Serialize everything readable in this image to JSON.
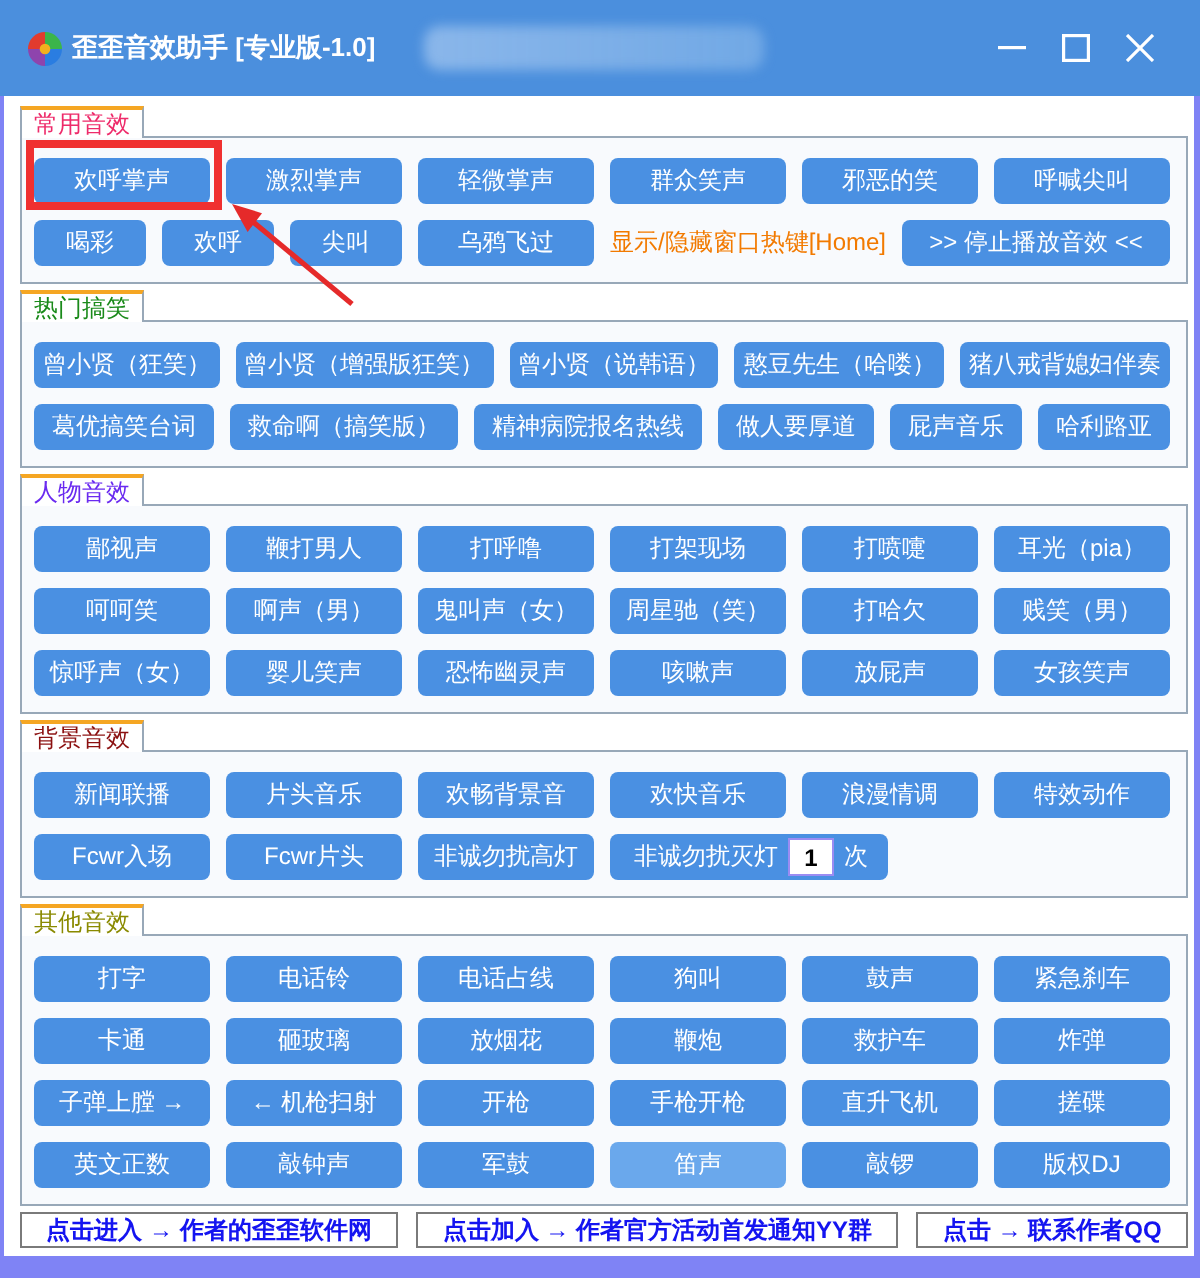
{
  "window": {
    "title": "歪歪音效助手 [专业版-1.0]"
  },
  "sections": [
    {
      "title": "常用音效",
      "color": "#ee2a6a",
      "buttons": [
        {
          "kind": "button",
          "label": "欢呼掌声",
          "highlighted": true
        },
        {
          "kind": "button",
          "label": "激烈掌声",
          "highlighted": false
        },
        {
          "kind": "button",
          "label": "轻微掌声",
          "highlighted": false
        },
        {
          "kind": "button",
          "label": "群众笑声",
          "highlighted": false
        },
        {
          "kind": "button",
          "label": "邪恶的笑",
          "highlighted": false
        },
        {
          "kind": "button",
          "label": "呼喊尖叫",
          "highlighted": false
        },
        {
          "kind": "compact",
          "label": "喝彩",
          "highlighted": false
        },
        {
          "kind": "compact",
          "label": "欢呼",
          "highlighted": false
        },
        {
          "kind": "compact",
          "label": "尖叫",
          "highlighted": false
        },
        {
          "kind": "button",
          "label": "乌鸦飞过",
          "highlighted": false
        },
        {
          "kind": "note",
          "label": "显示/隐藏窗口热键[Home]",
          "highlighted": false
        },
        {
          "kind": "stop",
          "label": ">> 停止播放音效 <<",
          "highlighted": false
        }
      ]
    },
    {
      "title": "热门搞笑",
      "color": "#1a8a1a",
      "buttons": [
        {
          "kind": "fill",
          "label": "曾小贤（狂笑）"
        },
        {
          "kind": "fill",
          "label": "曾小贤（增强版狂笑）"
        },
        {
          "kind": "fill",
          "label": "曾小贤（说韩语）"
        },
        {
          "kind": "fill",
          "label": "憨豆先生（哈喽）"
        },
        {
          "kind": "fill",
          "label": "猪八戒背媳妇伴奏"
        },
        {
          "kind": "fill",
          "label": "葛优搞笑台词"
        },
        {
          "kind": "fill",
          "label": "救命啊（搞笑版）"
        },
        {
          "kind": "fill",
          "label": "精神病院报名热线"
        },
        {
          "kind": "fill",
          "label": "做人要厚道"
        },
        {
          "kind": "fill",
          "label": "屁声音乐"
        },
        {
          "kind": "fill",
          "label": "哈利路亚"
        }
      ]
    },
    {
      "title": "人物音效",
      "color": "#6a2af0",
      "buttons": [
        {
          "kind": "button",
          "label": "鄙视声"
        },
        {
          "kind": "button",
          "label": "鞭打男人"
        },
        {
          "kind": "button",
          "label": "打呼噜"
        },
        {
          "kind": "button",
          "label": "打架现场"
        },
        {
          "kind": "button",
          "label": "打喷嚏"
        },
        {
          "kind": "button",
          "label": "耳光（pia）"
        },
        {
          "kind": "button",
          "label": "呵呵笑"
        },
        {
          "kind": "button",
          "label": "啊声（男）"
        },
        {
          "kind": "button",
          "label": "鬼叫声（女）"
        },
        {
          "kind": "button",
          "label": "周星驰（笑）"
        },
        {
          "kind": "button",
          "label": "打哈欠"
        },
        {
          "kind": "button",
          "label": "贱笑（男）"
        },
        {
          "kind": "button",
          "label": "惊呼声（女）"
        },
        {
          "kind": "button",
          "label": "婴儿笑声"
        },
        {
          "kind": "button",
          "label": "恐怖幽灵声"
        },
        {
          "kind": "button",
          "label": "咳嗽声"
        },
        {
          "kind": "button",
          "label": "放屁声"
        },
        {
          "kind": "button",
          "label": "女孩笑声"
        }
      ]
    },
    {
      "title": "背景音效",
      "color": "#8b1010",
      "buttons": [
        {
          "kind": "button",
          "label": "新闻联播"
        },
        {
          "kind": "button",
          "label": "片头音乐"
        },
        {
          "kind": "button",
          "label": "欢畅背景音"
        },
        {
          "kind": "button",
          "label": "欢快音乐"
        },
        {
          "kind": "button",
          "label": "浪漫情调"
        },
        {
          "kind": "button",
          "label": "特效动作"
        },
        {
          "kind": "button",
          "label": "Fcwr入场"
        },
        {
          "kind": "button",
          "label": "Fcwr片头"
        },
        {
          "kind": "button",
          "label": "非诚勿扰高灯"
        },
        {
          "kind": "counter",
          "label": "非诚勿扰灭灯",
          "value": "1",
          "suffix": "次"
        }
      ]
    },
    {
      "title": "其他音效",
      "color": "#8a8a00",
      "buttons": [
        {
          "kind": "button",
          "label": "打字",
          "hovered": false
        },
        {
          "kind": "button",
          "label": "电话铃",
          "hovered": false
        },
        {
          "kind": "button",
          "label": "电话占线",
          "hovered": false
        },
        {
          "kind": "button",
          "label": "狗叫",
          "hovered": false
        },
        {
          "kind": "button",
          "label": "鼓声",
          "hovered": false
        },
        {
          "kind": "button",
          "label": "紧急刹车",
          "hovered": false
        },
        {
          "kind": "button",
          "label": "卡通",
          "hovered": false
        },
        {
          "kind": "button",
          "label": "砸玻璃",
          "hovered": false
        },
        {
          "kind": "button",
          "label": "放烟花",
          "hovered": false
        },
        {
          "kind": "button",
          "label": "鞭炮",
          "hovered": false
        },
        {
          "kind": "button",
          "label": "救护车",
          "hovered": false
        },
        {
          "kind": "button",
          "label": "炸弹",
          "hovered": false
        },
        {
          "kind": "button",
          "label": "子弹上膛 →",
          "hovered": false
        },
        {
          "kind": "button",
          "label": "← 机枪扫射",
          "hovered": false
        },
        {
          "kind": "button",
          "label": "开枪",
          "hovered": false
        },
        {
          "kind": "button",
          "label": "手枪开枪",
          "hovered": false
        },
        {
          "kind": "button",
          "label": "直升飞机",
          "hovered": false
        },
        {
          "kind": "button",
          "label": "搓碟",
          "hovered": false
        },
        {
          "kind": "button",
          "label": "英文正数",
          "hovered": false
        },
        {
          "kind": "button",
          "label": "敲钟声",
          "hovered": false
        },
        {
          "kind": "button",
          "label": "军鼓",
          "hovered": false
        },
        {
          "kind": "button",
          "label": "笛声",
          "hovered": true
        },
        {
          "kind": "button",
          "label": "敲锣",
          "hovered": false
        },
        {
          "kind": "button",
          "label": "版权DJ",
          "hovered": false
        }
      ]
    }
  ],
  "links": [
    "点击进入 → 作者的歪歪软件网",
    "点击加入 → 作者官方活动首发通知YY群",
    "点击 → 联系作者QQ"
  ]
}
